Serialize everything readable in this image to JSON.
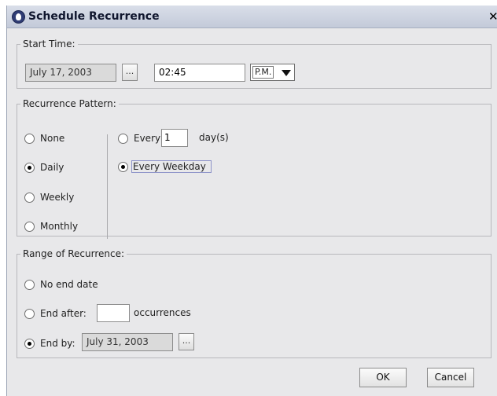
{
  "window": {
    "title": "Schedule Recurrence",
    "close_symbol": "✕",
    "icon": "app-logo-icon"
  },
  "start_time": {
    "legend": "Start Time:",
    "date": "July 17, 2003",
    "date_picker_label": "...",
    "time": "02:45",
    "ampm": "P.M."
  },
  "pattern": {
    "legend": "Recurrence Pattern:",
    "options": [
      {
        "label": "None",
        "selected": false
      },
      {
        "label": "Daily",
        "selected": true
      },
      {
        "label": "Weekly",
        "selected": false
      },
      {
        "label": "Monthly",
        "selected": false
      }
    ],
    "every_label": "Every",
    "every_value": "1",
    "days_label": "day(s)",
    "every_weekday_label": "Every Weekday"
  },
  "range": {
    "legend": "Range of Recurrence:",
    "no_end_label": "No end date",
    "end_after_label": "End after:",
    "end_after_value": "",
    "occurrences_label": "occurrences",
    "end_by_label": "End by:",
    "end_by_date": "July 31, 2003",
    "date_picker_label": "..."
  },
  "buttons": {
    "ok": "OK",
    "cancel": "Cancel"
  }
}
